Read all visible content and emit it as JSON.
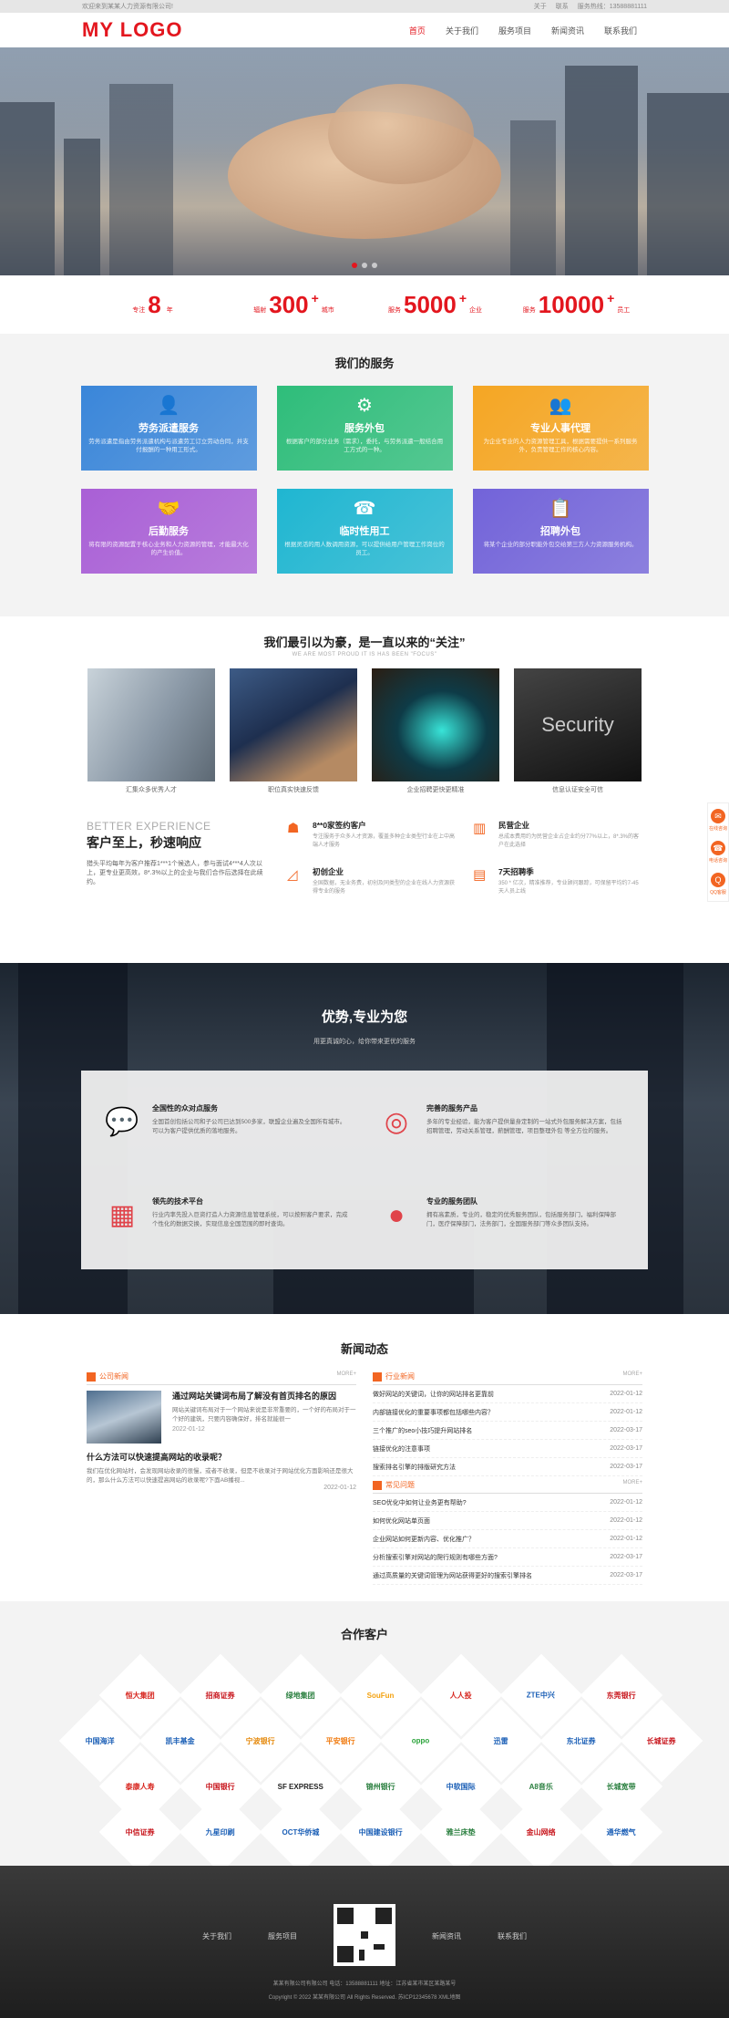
{
  "topbar": {
    "welcome": "欢迎来到某某人力资源有限公司!",
    "links": [
      "关于",
      "联系",
      "服务热线：13588881111"
    ]
  },
  "header": {
    "logo": "MY LOGO",
    "nav": [
      "首页",
      "关于我们",
      "服务项目",
      "新闻资讯",
      "联系我们"
    ]
  },
  "stats": [
    {
      "pre": "专注",
      "num": "8",
      "suf": "年",
      "sup": ""
    },
    {
      "pre": "辐射",
      "num": "300",
      "suf": "城市",
      "sup": "+"
    },
    {
      "pre": "服务",
      "num": "5000",
      "suf": "企业",
      "sup": "+"
    },
    {
      "pre": "服务",
      "num": "10000",
      "suf": "员工",
      "sup": "+"
    }
  ],
  "services": {
    "title": "我们的服务",
    "items": [
      {
        "title": "劳务派遣服务",
        "desc": "劳务派遣是指由劳务派遣机构与派遣劳工订立劳动合同，并支付报酬的一种用工形式。",
        "color": "#3a86d9",
        "icon": "👤"
      },
      {
        "title": "服务外包",
        "desc": "根据客户的部分业务（需求），委托，与劳务派遣一般结合用工方式的一种。",
        "color": "#2ebd7a",
        "icon": "⚙"
      },
      {
        "title": "专业人事代理",
        "desc": "为企业专业的人力资源管理工具，根据需要提供一系列服务外，负责管理工作的核心内容。",
        "color": "#f5a623",
        "icon": "👥"
      },
      {
        "title": "后勤服务",
        "desc": "将有限的资源配置于核心业务和人力资源的管理，才能最大化的产生价值。",
        "color": "#a95fd6",
        "icon": "🤝"
      },
      {
        "title": "临时性用工",
        "desc": "根据灵活的用人数调用资源，可以提供给用户管理工作岗位的员工。",
        "color": "#1fb6d1",
        "icon": "☎"
      },
      {
        "title": "招聘外包",
        "desc": "将某个企业的部分职能外包交给第三方人力资源服务机构。",
        "color": "#7263d9",
        "icon": "📋"
      }
    ]
  },
  "focus": {
    "title": "我们最引以为豪，是一直以来的“关注”",
    "sub": "WE ARE MOST PROUD IT IS HAS BEEN \"FOCUS\"",
    "pics": [
      "汇集众多优秀人才",
      "职位真实快速反馈",
      "企业招聘更快更精准",
      "信息认证安全可信"
    ],
    "be": "BETTER EXPERIENCE",
    "headline": "客户至上，秒速响应",
    "para": "猎头平均每年为客户推荐1***1个候选人，参与面试4***4人次以上，更专业更高效，8*.3%以上的企业与我们合作后选择在此续约。",
    "feats": [
      {
        "t": "8**0家签约客户",
        "d": "专注服务于众多人才资源，覆盖多种企业类型行业在上中高端人才服务"
      },
      {
        "t": "民营企业",
        "d": "总成本费用约为民营企业占企业约分77%以上，8*.3%的客户在此选择"
      },
      {
        "t": "初创企业",
        "d": "全国数据，无业务费，初创及同类型的企业在线人力资源获得专业的服务"
      },
      {
        "t": "7天招聘季",
        "d": "350 * 亿次，精准推荐，专业顾问跟踪，可保留平均约7-45天人员上线"
      }
    ]
  },
  "advantage": {
    "title": "优势,专业为您",
    "sub": "用更真诚的心，给你带来更优的服务",
    "items": [
      {
        "t": "全国性的众对点服务",
        "d": "全国首创包括公司和子公司已达到500多家，联盟企业遍及全国所有城市。可以为客户提供优质的落地服务。"
      },
      {
        "t": "完善的服务产品",
        "d": "多年的专业经验，能为客户提供量身定制的一站式外包服务解决方案，包括招聘管理，劳动关系管理，薪酬管理，项目整理外包 等全方位的服务。"
      },
      {
        "t": "领先的技术平台",
        "d": "行业内率先投入巨资打造人力资源信息管理系统，可以按照客户要求，完成个性化的数据交换，实现信息全国范围的即时查询。"
      },
      {
        "t": "专业的服务团队",
        "d": "拥有高素质，专业的，稳定的优秀服务团队，包括服务部门，福利保障部门，医疗保障部门，法务部门，全国服务部门等众多团队支持。"
      }
    ]
  },
  "news": {
    "title": "新闻动态",
    "more": "MORE+",
    "company": {
      "label": "公司新闻",
      "headline": "通过网站关键词布局了解没有首页排名的原因",
      "excerpt": "网站关键词布局对于一个网站来说是非常重要的，一个好的布局对于一个好的建筑，只要内容确保好，排名就能很一",
      "date": "2022-01-12",
      "q": "什么方法可以快速提高网站的收录呢？",
      "qtext": "我们在优化网站时，会发现网站收录的很慢，或者不收录，但是不收录对于网站优化方面影响还是很大的，那么什么方法可以快速提高网站的收录呢?下面AB播视...",
      "qdate": "2022-01-12"
    },
    "industry": {
      "label": "行业新闻",
      "items": [
        {
          "t": "做好网站的关键词，让你的网站排名更靠前",
          "d": "2022-01-12"
        },
        {
          "t": "内部链接优化的重要事项都包括哪些内容？",
          "d": "2022-01-12"
        },
        {
          "t": "三个推广的seo小技巧提升网站排名",
          "d": "2022-03-17"
        },
        {
          "t": "链接优化的注意事项",
          "d": "2022-03-17"
        },
        {
          "t": "搜索排名引擎的排版研究方法",
          "d": "2022-03-17"
        }
      ]
    },
    "faq": {
      "label": "常见问题",
      "items": [
        {
          "t": "SEO优化中如何让业务更有帮助?",
          "d": "2022-01-12"
        },
        {
          "t": "如何优化网站单页面",
          "d": "2022-01-12"
        },
        {
          "t": "企业网站如何更新内容、优化推广？",
          "d": "2022-01-12"
        },
        {
          "t": "分析搜索引擎对网站的爬行规则有哪些方面?",
          "d": "2022-03-17"
        },
        {
          "t": "通过高质量的关键词管理为网站获得更好的搜索引擎排名",
          "d": "2022-03-17"
        }
      ]
    }
  },
  "partners": {
    "title": "合作客户",
    "logos": [
      {
        "n": "恒大集团",
        "c": "#d7261f"
      },
      {
        "n": "招商证券",
        "c": "#c8161d"
      },
      {
        "n": "绿地集团",
        "c": "#2a7f3f"
      },
      {
        "n": "SouFun",
        "c": "#f3a10f"
      },
      {
        "n": "人人投",
        "c": "#d7261f"
      },
      {
        "n": "ZTE中兴",
        "c": "#1b5fb6"
      },
      {
        "n": "东莞银行",
        "c": "#c8161d"
      },
      {
        "n": "中国海洋",
        "c": "#1b5fb6"
      },
      {
        "n": "凯丰基金",
        "c": "#1b5fb6"
      },
      {
        "n": "宁波银行",
        "c": "#e58a0e"
      },
      {
        "n": "平安银行",
        "c": "#f07b11"
      },
      {
        "n": "oppo",
        "c": "#2aa33a"
      },
      {
        "n": "迅雷",
        "c": "#1b5fb6"
      },
      {
        "n": "东北证券",
        "c": "#1b5fb6"
      },
      {
        "n": "长城证券",
        "c": "#c8161d"
      },
      {
        "n": "泰康人寿",
        "c": "#d7261f"
      },
      {
        "n": "中国银行",
        "c": "#c8161d"
      },
      {
        "n": "SF EXPRESS",
        "c": "#222"
      },
      {
        "n": "锦州银行",
        "c": "#2a7f3f"
      },
      {
        "n": "中软国际",
        "c": "#1b5fb6"
      },
      {
        "n": "A8音乐",
        "c": "#2a7f3f"
      },
      {
        "n": "长城宽带",
        "c": "#2a7f3f"
      },
      {
        "n": "中信证券",
        "c": "#c8161d"
      },
      {
        "n": "九星印刷",
        "c": "#1b5fb6"
      },
      {
        "n": "OCT华侨城",
        "c": "#1b5fb6"
      },
      {
        "n": "中国建设银行",
        "c": "#1b5fb6"
      },
      {
        "n": "雅兰床垫",
        "c": "#2a7f3f"
      },
      {
        "n": "金山网络",
        "c": "#c8161d"
      },
      {
        "n": "通华燃气",
        "c": "#1b5fb6"
      }
    ]
  },
  "footer": {
    "nav": [
      "关于我们",
      "服务项目",
      "新闻资讯",
      "联系我们"
    ],
    "info": "某某有限公司有限公司  电话：13588881111  地址：江苏省某市某区某路某号",
    "copy": "Copyright © 2022 某某有限公司 All Rights Reserved. 苏ICP12345678 XML地图"
  },
  "side": [
    "在线咨询",
    "电话咨询",
    "QQ客服"
  ]
}
